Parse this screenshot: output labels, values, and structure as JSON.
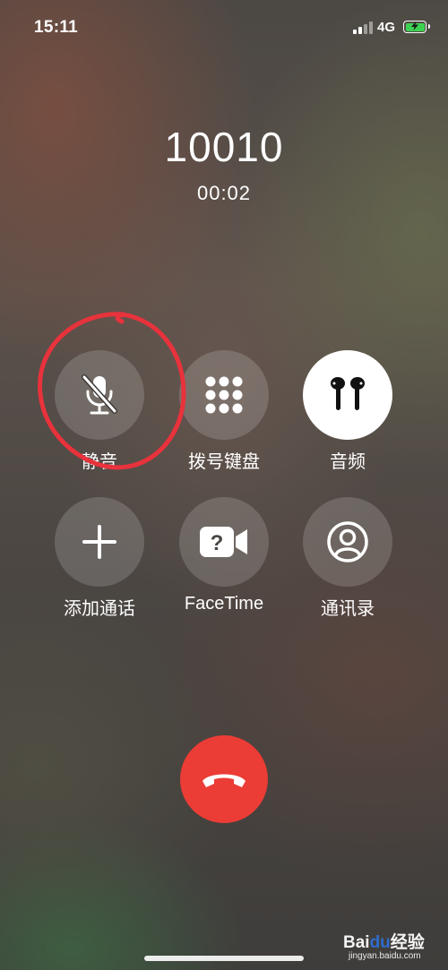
{
  "status_bar": {
    "time": "15:11",
    "network": "4G",
    "battery_color": "#3cd251"
  },
  "call": {
    "number": "10010",
    "duration": "00:02"
  },
  "controls": [
    {
      "id": "mute",
      "label": "静音",
      "icon": "mic-slash-icon",
      "active": false
    },
    {
      "id": "keypad",
      "label": "拨号键盘",
      "icon": "keypad-icon",
      "active": false
    },
    {
      "id": "audio",
      "label": "音频",
      "icon": "airpods-icon",
      "active": true
    },
    {
      "id": "add-call",
      "label": "添加通话",
      "icon": "plus-icon",
      "active": false
    },
    {
      "id": "facetime",
      "label": "FaceTime",
      "icon": "facetime-question-icon",
      "active": false
    },
    {
      "id": "contacts",
      "label": "通讯录",
      "icon": "person-circle-icon",
      "active": false
    }
  ],
  "end_call": {
    "icon": "phone-hangup-icon",
    "color": "#eb3c36"
  },
  "annotation": {
    "color": "#e8323c"
  },
  "watermark": {
    "logo_prefix": "Bai",
    "logo_paw": "du",
    "logo_suffix": "经验",
    "url": "jingyan.baidu.com"
  }
}
